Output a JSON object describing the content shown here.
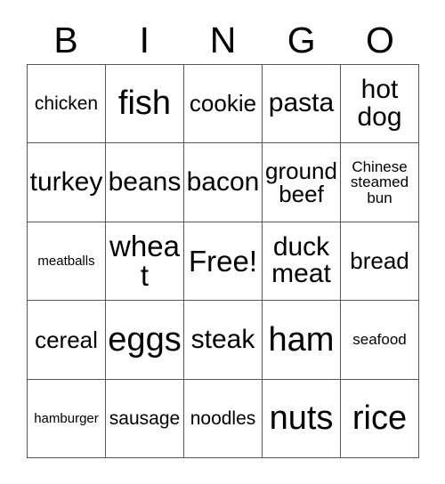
{
  "card": {
    "title": "Bingo Card",
    "background_color": "#ffffff",
    "text_color": "#000000",
    "border_color": "#555555"
  },
  "header": {
    "letters": [
      "B",
      "I",
      "N",
      "G",
      "O"
    ]
  },
  "grid": {
    "columns": 5,
    "rows": 5,
    "cells": [
      {
        "text": "chicken",
        "size": "fs-xs"
      },
      {
        "text": "fish",
        "size": "fs-xl"
      },
      {
        "text": "cookie",
        "size": "fs-sm"
      },
      {
        "text": "pasta",
        "size": "fs-md"
      },
      {
        "text": "hot dog",
        "size": "fs-md"
      },
      {
        "text": "turkey",
        "size": "fs-md"
      },
      {
        "text": "beans",
        "size": "fs-md"
      },
      {
        "text": "bacon",
        "size": "fs-md"
      },
      {
        "text": "ground beef",
        "size": "fs-sm"
      },
      {
        "text": "Chinese steamed bun",
        "size": "fs-xxs"
      },
      {
        "text": "meatballs",
        "size": "fs-tiny"
      },
      {
        "text": "wheat",
        "size": "fs-lg"
      },
      {
        "text": "Free!",
        "size": "fs-lg"
      },
      {
        "text": "duck meat",
        "size": "fs-md"
      },
      {
        "text": "bread",
        "size": "fs-sm"
      },
      {
        "text": "cereal",
        "size": "fs-sm"
      },
      {
        "text": "eggs",
        "size": "fs-xl"
      },
      {
        "text": "steak",
        "size": "fs-md"
      },
      {
        "text": "ham",
        "size": "fs-xl"
      },
      {
        "text": "seafood",
        "size": "fs-xxs"
      },
      {
        "text": "hamburger",
        "size": "fs-tiny"
      },
      {
        "text": "sausage",
        "size": "fs-xs"
      },
      {
        "text": "noodles",
        "size": "fs-xs"
      },
      {
        "text": "nuts",
        "size": "fs-xl"
      },
      {
        "text": "rice",
        "size": "fs-xl"
      }
    ]
  }
}
